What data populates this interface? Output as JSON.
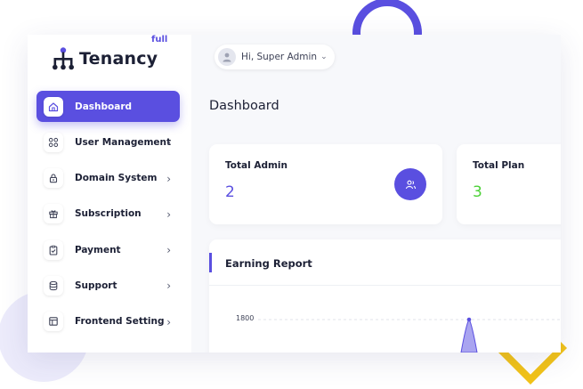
{
  "brand": {
    "name": "Tenancy",
    "superscript": "full",
    "accent": "#5a4fe0"
  },
  "user": {
    "greeting": "Hi, Super Admin"
  },
  "sidebar": {
    "items": [
      {
        "label": "Dashboard",
        "icon": "home-icon",
        "active": true
      },
      {
        "label": "User Management",
        "icon": "grid-icon",
        "active": false
      },
      {
        "label": "Domain System",
        "icon": "lock-icon",
        "active": false
      },
      {
        "label": "Subscription",
        "icon": "gift-icon",
        "active": false
      },
      {
        "label": "Payment",
        "icon": "clipboard-check-icon",
        "active": false
      },
      {
        "label": "Support",
        "icon": "database-icon",
        "active": false
      },
      {
        "label": "Frontend Setting",
        "icon": "layout-icon",
        "active": false
      }
    ]
  },
  "page": {
    "title": "Dashboard"
  },
  "stats": [
    {
      "label": "Total Admin",
      "value": "2",
      "color": "#5a4fe0",
      "icon": "users-icon"
    },
    {
      "label": "Total Plan",
      "value": "3",
      "color": "#4cd137"
    }
  ],
  "earning_report": {
    "title": "Earning Report",
    "y_ticks": [
      "1800"
    ],
    "peak_value": 1800,
    "accent": "#5a4fe0"
  }
}
